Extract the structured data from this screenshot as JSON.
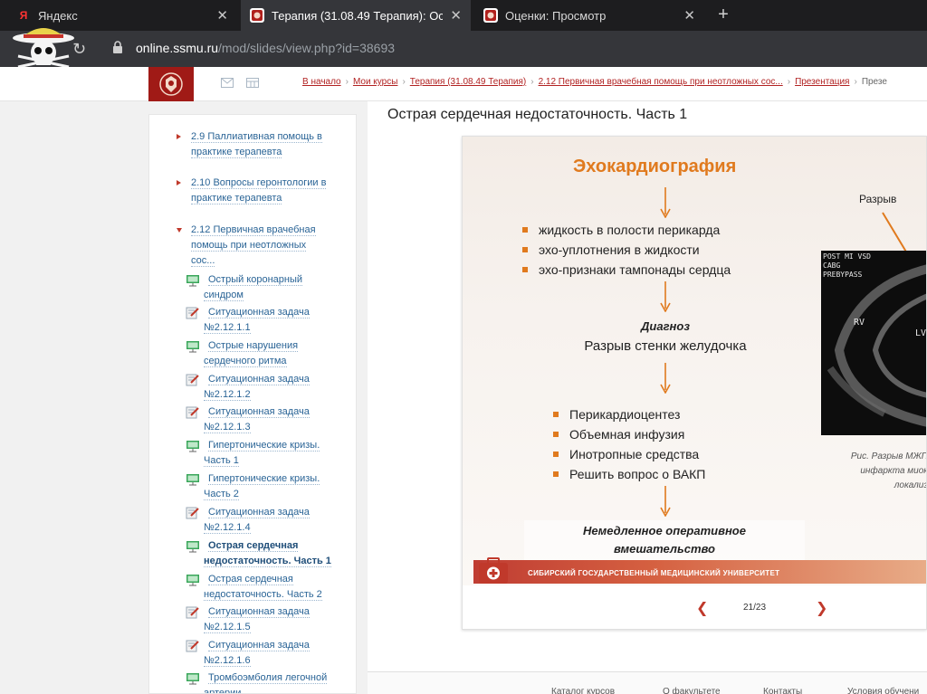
{
  "browser": {
    "tabs": [
      {
        "title": "Яндекс",
        "favicon": "Я",
        "active": false
      },
      {
        "title": "Терапия (31.08.49 Терапия): Ост",
        "favicon": "ssmu-crest",
        "active": true
      },
      {
        "title": "Оценки: Просмотр",
        "favicon": "ssmu-crest",
        "active": false
      }
    ],
    "url_host": "online.ssmu.ru",
    "url_path": "/mod/slides/view.php?id=38693"
  },
  "breadcrumb": [
    "В начало",
    "Мои курсы",
    "Терапия (31.08.49 Терапия)",
    "2.12 Первичная врачебная помощь при неотложных сос...",
    "Презентация",
    "Презе"
  ],
  "sidebar": {
    "sections": [
      {
        "line1": "2.9 Паллиативная помощь в",
        "line2": "практике терапевта",
        "line3": "",
        "expanded": false
      },
      {
        "line1": "2.10 Вопросы геронтологии в",
        "line2": "практике терапевта",
        "line3": "",
        "expanded": false
      },
      {
        "line1": "2.12 Первичная врачебная",
        "line2": "помощь при неотложных",
        "line3": "сос...",
        "expanded": true
      }
    ],
    "items": [
      {
        "type": "presentation",
        "line1": "Острый коронарный",
        "line2": "синдром"
      },
      {
        "type": "task",
        "line1": "Ситуационная задача",
        "line2": "№2.12.1.1"
      },
      {
        "type": "presentation",
        "line1": "Острые нарушения",
        "line2": "сердечного ритма"
      },
      {
        "type": "task",
        "line1": "Ситуационная задача",
        "line2": "№2.12.1.2"
      },
      {
        "type": "task",
        "line1": "Ситуационная задача",
        "line2": "№2.12.1.3"
      },
      {
        "type": "presentation",
        "line1": "Гипертонические кризы.",
        "line2": "Часть 1"
      },
      {
        "type": "presentation",
        "line1": "Гипертонические кризы.",
        "line2": "Часть 2"
      },
      {
        "type": "task",
        "line1": "Ситуационная задача",
        "line2": "№2.12.1.4"
      },
      {
        "type": "presentation",
        "line1": "Острая сердечная",
        "line2": "недостаточность. Часть 1",
        "current": true
      },
      {
        "type": "presentation",
        "line1": "Острая сердечная",
        "line2": "недостаточность. Часть 2"
      },
      {
        "type": "task",
        "line1": "Ситуационная задача",
        "line2": "№2.12.1.5"
      },
      {
        "type": "task",
        "line1": "Ситуационная задача",
        "line2": "№2.12.1.6"
      },
      {
        "type": "presentation",
        "line1": "Тромбоэмболия легочной",
        "line2": "артерии"
      }
    ]
  },
  "main": {
    "page_title": "Острая сердечная недостаточность. Часть 1"
  },
  "slide": {
    "title": "Эхокардиография",
    "findings": [
      "жидкость в полости перикарда",
      "эхо-уплотнения в жидкости",
      "эхо-признаки тампонады сердца"
    ],
    "diagnosis_heading": "Диагноз",
    "diagnosis": "Разрыв стенки желудочка",
    "treatment": [
      "Перикардиоцентез",
      "Объемная инфузия",
      "Инотропные средства",
      "Решить вопрос о ВАКП"
    ],
    "urgent_line1": "Немедленное оперативное",
    "urgent_line2": "вмешательство",
    "rupture_label": "Разрыв",
    "echo_overlay": [
      "POST MI VSD",
      "CABG",
      "PREBYPASS"
    ],
    "echo_labels": [
      "RV",
      "LV"
    ],
    "caption_line1": "Рис. Разрыв МЖП",
    "caption_line2": "инфаркта миок",
    "caption_line3": "локализ",
    "footer_university": "СИБИРСКИЙ ГОСУДАРСТВЕННЫЙ МЕДИЦИНСКИЙ УНИВЕРСИТЕТ"
  },
  "pager": {
    "current": 21,
    "total": 23,
    "label": "21/23"
  },
  "footer_nav": [
    "Каталог курсов",
    "О факультете",
    "Контакты",
    "Условия обучени"
  ],
  "colors": {
    "accent": "#e07a1e",
    "brand": "#a01a16",
    "link": "#2a6496"
  }
}
